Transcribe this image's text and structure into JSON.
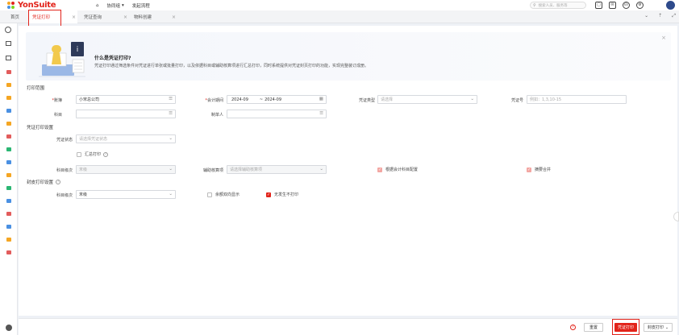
{
  "app": {
    "logo_text": "YonSuite",
    "nav": [
      "协同组",
      "发起流程"
    ],
    "search_placeholder": "搜索人员、服务等"
  },
  "tabs": [
    {
      "label": "首页"
    },
    {
      "label": "凭证打印"
    },
    {
      "label": "凭证查询"
    },
    {
      "label": "物料创建"
    }
  ],
  "banner": {
    "title": "什么是凭证打印?",
    "desc": "凭证打印通过筛选条件对凭证进行单张或批量打印，以及依据科目或辅助核算项进行汇总打印，同时系统提供对凭证封页打印的功能，实现完整装订成册。"
  },
  "range": {
    "section": "打印范围",
    "account_book_label": "账簿",
    "account_book_value": "小宋总公司",
    "period_label": "会计期间",
    "period_from": "2024-09",
    "period_sep": "~",
    "period_to": "2024-09",
    "voucher_type_label": "凭证类型",
    "voucher_type_placeholder": "请选择",
    "voucher_no_label": "凭证号",
    "voucher_no_placeholder": "例如：1,3,10-15",
    "subject_label": "科目",
    "maker_label": "制单人"
  },
  "print_settings": {
    "section": "凭证打印设置",
    "status_label": "凭证状态",
    "status_placeholder": "请选择凭证状态",
    "summary_print": "汇总打印",
    "subject_level_label": "科目级次",
    "subject_level_value": "末级",
    "aux_label": "辅助核算项",
    "aux_placeholder": "请选择辅助核算项",
    "config_by_subject": "根据会计科目配置",
    "merge_summary": "摘要合并"
  },
  "cover_settings": {
    "section": "封皮打印设置",
    "subject_level_label": "科目级次",
    "subject_level_value": "末级",
    "balance_two_way": "余额双向显示",
    "no_occurrence_no_print": "无发生不打印"
  },
  "footer": {
    "help": "?",
    "reset": "重置",
    "print": "凭证打印",
    "cover_print": "封皮打印"
  },
  "colors": {
    "brand": "#e2231a"
  }
}
